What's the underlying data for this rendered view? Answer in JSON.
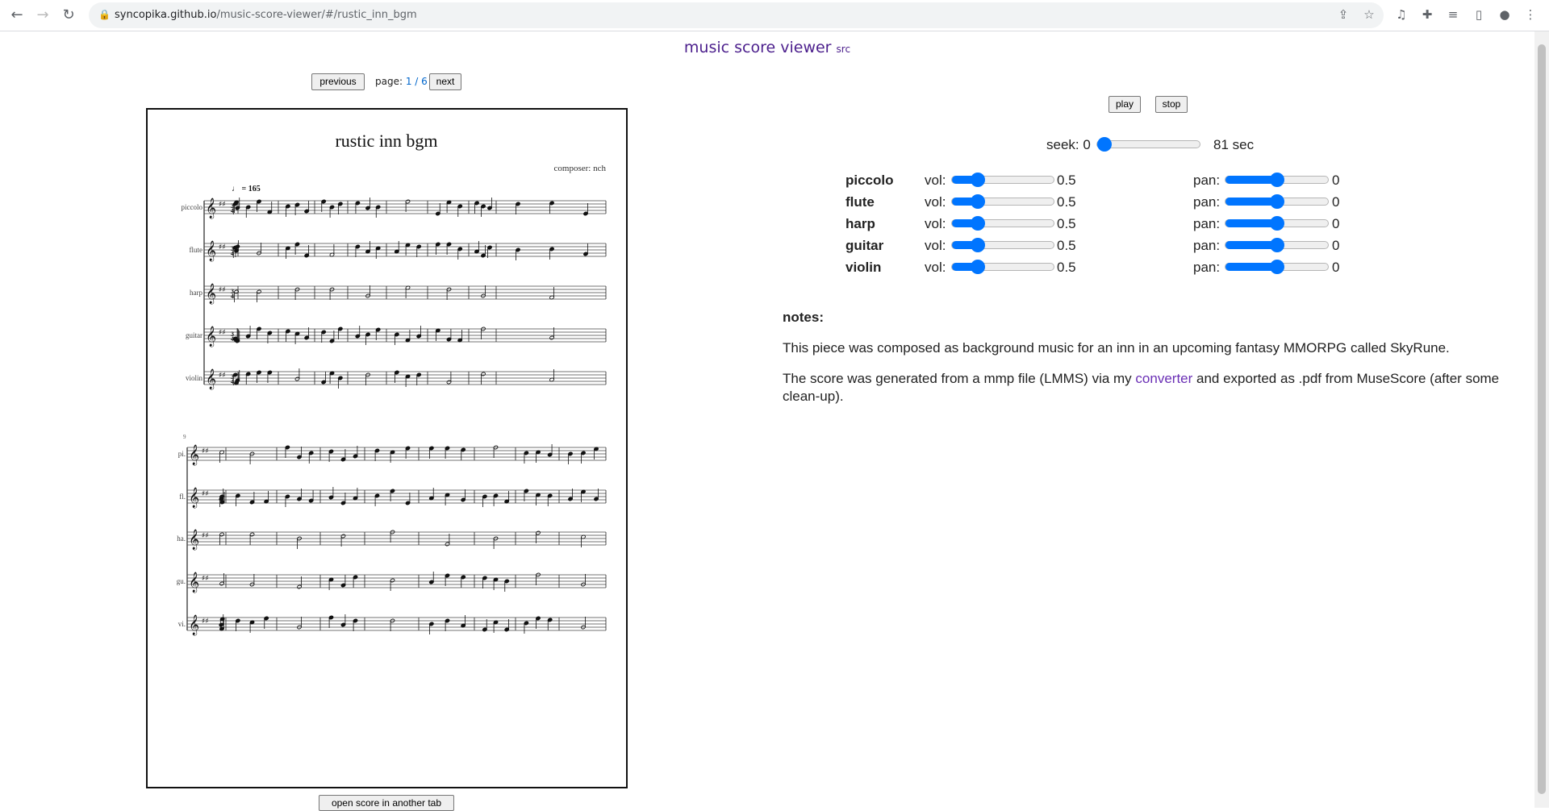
{
  "browser": {
    "url_host": "syncopika.github.io",
    "url_path": "/music-score-viewer/#/rustic_inn_bgm"
  },
  "header": {
    "title": "music score viewer",
    "src_link": "src"
  },
  "pager": {
    "previous": "previous",
    "page_label": "page:",
    "page": "1 / 6",
    "next": "next"
  },
  "score": {
    "title": "rustic inn bgm",
    "composer": "composer: nch",
    "tempo": "♩ = 165",
    "measure_number": "9",
    "system1_labels": [
      "piccolo",
      "flute",
      "harp",
      "guitar",
      "violin"
    ],
    "system2_labels": [
      "pi.",
      "fl.",
      "ha.",
      "gu.",
      "vi."
    ],
    "open_button": "open score in another tab"
  },
  "player": {
    "play": "play",
    "stop": "stop",
    "seek_label": "seek: 0",
    "seek_fraction": 0,
    "duration": "81 sec"
  },
  "instruments": [
    {
      "name": "piccolo",
      "vol_label": "vol:",
      "vol": "0.5",
      "pan_label": "pan:",
      "pan": "0"
    },
    {
      "name": "flute",
      "vol_label": "vol:",
      "vol": "0.5",
      "pan_label": "pan:",
      "pan": "0"
    },
    {
      "name": "harp",
      "vol_label": "vol:",
      "vol": "0.5",
      "pan_label": "pan:",
      "pan": "0"
    },
    {
      "name": "guitar",
      "vol_label": "vol:",
      "vol": "0.5",
      "pan_label": "pan:",
      "pan": "0"
    },
    {
      "name": "violin",
      "vol_label": "vol:",
      "vol": "0.5",
      "pan_label": "pan:",
      "pan": "0"
    }
  ],
  "notes": {
    "heading": "notes:",
    "p1": "This piece was composed as background music for an inn in an upcoming fantasy MMORPG called SkyRune.",
    "p2_before": "The score was generated from a mmp file (LMMS) via my ",
    "p2_link": "converter",
    "p2_after": " and exported as .pdf from MuseScore (after some clean-up)."
  },
  "colors": {
    "accent": "#0075ff",
    "title": "#4b1e8c",
    "link": "#6a2fb5"
  }
}
